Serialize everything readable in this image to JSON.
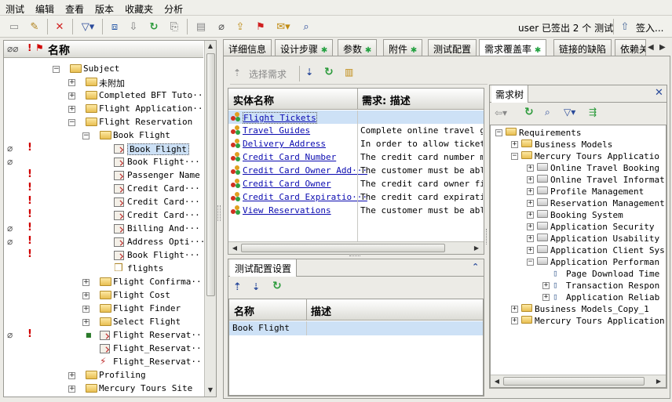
{
  "menu": [
    "测试",
    "编辑",
    "查看",
    "版本",
    "收藏夹",
    "分析"
  ],
  "toolbar": {
    "user_status": "user 已签出 2 个 测试",
    "checkin_label": "签入..."
  },
  "tree": {
    "header": "名称",
    "items": [
      {
        "label": "Subject",
        "indent": 0,
        "expander": "−",
        "icon": "folder"
      },
      {
        "label": "未附加",
        "indent": 1,
        "expander": "+",
        "icon": "folder"
      },
      {
        "label": "Completed BFT Tuto···",
        "indent": 1,
        "expander": "+",
        "icon": "folder"
      },
      {
        "label": "Flight  Application···",
        "indent": 1,
        "expander": "+",
        "icon": "folder"
      },
      {
        "label": "Flight Reservation",
        "indent": 1,
        "expander": "−",
        "icon": "folder"
      },
      {
        "label": "Book Flight",
        "indent": 2,
        "expander": "−",
        "icon": "folder"
      },
      {
        "label": "Book Flight",
        "indent": 3,
        "expander": "",
        "icon": "test",
        "clip": true,
        "excl": true,
        "selected": true
      },
      {
        "label": "Book Flight···",
        "indent": 3,
        "expander": "",
        "icon": "test",
        "clip": true
      },
      {
        "label": "Passenger Name",
        "indent": 3,
        "expander": "",
        "icon": "test",
        "excl": true
      },
      {
        "label": "Credit Card···",
        "indent": 3,
        "expander": "",
        "icon": "test",
        "excl": true
      },
      {
        "label": "Credit Card···",
        "indent": 3,
        "expander": "",
        "icon": "test",
        "excl": true
      },
      {
        "label": "Credit Card···",
        "indent": 3,
        "expander": "",
        "icon": "test",
        "excl": true
      },
      {
        "label": "Billing And···",
        "indent": 3,
        "expander": "",
        "icon": "test",
        "clip": true,
        "excl": true
      },
      {
        "label": "Address Opti···",
        "indent": 3,
        "expander": "",
        "icon": "test",
        "clip": true,
        "excl": true
      },
      {
        "label": "Book Flight···",
        "indent": 3,
        "expander": "",
        "icon": "test",
        "excl": true
      },
      {
        "label": "flights",
        "indent": 3,
        "expander": "",
        "icon": "box"
      },
      {
        "label": "Flight Confirma···",
        "indent": 2,
        "expander": "+",
        "icon": "folder"
      },
      {
        "label": "Flight Cost",
        "indent": 2,
        "expander": "+",
        "icon": "folder"
      },
      {
        "label": "Flight Finder",
        "indent": 2,
        "expander": "+",
        "icon": "folder"
      },
      {
        "label": "Select Flight",
        "indent": 2,
        "expander": "+",
        "icon": "folder"
      },
      {
        "label": "Flight  Reservat···",
        "indent": 2,
        "expander": "",
        "icon": "test",
        "clip": true,
        "excl": true,
        "lock": true
      },
      {
        "label": "Flight_Reservat···",
        "indent": 2,
        "expander": "",
        "icon": "test"
      },
      {
        "label": "Flight_Reservat···",
        "indent": 2,
        "expander": "",
        "icon": "test2"
      },
      {
        "label": "Profiling",
        "indent": 1,
        "expander": "+",
        "icon": "folder"
      },
      {
        "label": "Mercury Tours Site",
        "indent": 1,
        "expander": "+",
        "icon": "folder"
      }
    ]
  },
  "tabs": [
    {
      "label": "详细信息",
      "tick": false
    },
    {
      "label": "设计步骤",
      "tick": true
    },
    {
      "label": "参数",
      "tick": true
    },
    {
      "label": "附件",
      "tick": true
    },
    {
      "label": "测试配置",
      "tick": false
    },
    {
      "label": "需求覆盖率",
      "tick": true,
      "active": true
    },
    {
      "label": "链接的缺陷",
      "tick": false
    },
    {
      "label": "依赖关",
      "tick": false
    }
  ],
  "coverage": {
    "select_req_label": "选择需求",
    "col_name": "实体名称",
    "col_desc": "需求: 描述",
    "rows": [
      {
        "name": "Flight Tickets",
        "desc": ""
      },
      {
        "name": "Travel Guides",
        "desc": "Complete online travel gu"
      },
      {
        "name": "Delivery Address",
        "desc": "In order to allow ticket"
      },
      {
        "name": "Credit Card Number",
        "desc": "The credit card number mus"
      },
      {
        "name": "Credit Card Owner Add···",
        "desc": "The customer must be able"
      },
      {
        "name": "Credit Card Owner",
        "desc": "The credit card owner firs"
      },
      {
        "name": "Credit Card Expiratio···",
        "desc": "The credit card expiration"
      },
      {
        "name": "View Reservations",
        "desc": "The customer must be able"
      }
    ]
  },
  "config": {
    "tab_label": "测试配置设置",
    "col_name": "名称",
    "col_desc": "描述",
    "rows": [
      {
        "name": "Book Flight",
        "desc": ""
      }
    ]
  },
  "reqtree": {
    "tab_label": "需求树",
    "items": [
      {
        "label": "Requirements",
        "indent": 0,
        "expander": "−",
        "icon": "folder"
      },
      {
        "label": "Business Models",
        "indent": 1,
        "expander": "+",
        "icon": "folder"
      },
      {
        "label": "Mercury Tours Applicatio",
        "indent": 1,
        "expander": "−",
        "icon": "folder"
      },
      {
        "label": "Online Travel Booking",
        "indent": 2,
        "expander": "+",
        "icon": "gray"
      },
      {
        "label": "Online Travel Informat",
        "indent": 2,
        "expander": "+",
        "icon": "gray"
      },
      {
        "label": "Profile Management",
        "indent": 2,
        "expander": "+",
        "icon": "gray"
      },
      {
        "label": "Reservation Management",
        "indent": 2,
        "expander": "+",
        "icon": "gray"
      },
      {
        "label": "Booking System",
        "indent": 2,
        "expander": "+",
        "icon": "gray"
      },
      {
        "label": "Application Security",
        "indent": 2,
        "expander": "+",
        "icon": "gray"
      },
      {
        "label": "Application Usability",
        "indent": 2,
        "expander": "+",
        "icon": "gray"
      },
      {
        "label": "Application Client Sys",
        "indent": 2,
        "expander": "+",
        "icon": "gray"
      },
      {
        "label": "Application Performan",
        "indent": 2,
        "expander": "−",
        "icon": "gray"
      },
      {
        "label": "Page Download Time",
        "indent": 3,
        "expander": "",
        "icon": "page"
      },
      {
        "label": "Transaction Respon",
        "indent": 3,
        "expander": "+",
        "icon": "page"
      },
      {
        "label": "Application Reliab",
        "indent": 3,
        "expander": "+",
        "icon": "page"
      },
      {
        "label": "Business Models_Copy_1",
        "indent": 1,
        "expander": "+",
        "icon": "folder"
      },
      {
        "label": "Mercury Tours Application",
        "indent": 1,
        "expander": "+",
        "icon": "folder"
      }
    ]
  }
}
